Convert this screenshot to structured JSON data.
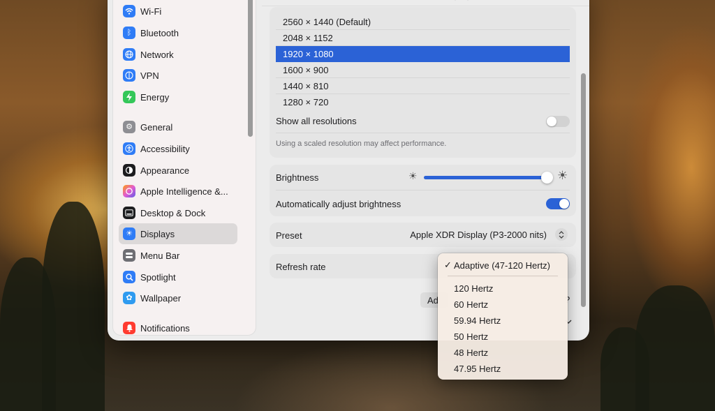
{
  "sidebar": {
    "items": [
      {
        "label": "Wi-Fi",
        "icon": "wifi-icon",
        "color": "#2f7cf6"
      },
      {
        "label": "Bluetooth",
        "icon": "bluetooth-icon",
        "color": "#2f7cf6"
      },
      {
        "label": "Network",
        "icon": "globe-icon",
        "color": "#2f7cf6"
      },
      {
        "label": "VPN",
        "icon": "vpn-icon",
        "color": "#2f7cf6"
      },
      {
        "label": "Energy",
        "icon": "bolt-icon",
        "color": "#34c759"
      },
      {
        "label": "General",
        "icon": "gear-icon",
        "color": "#8e8e93"
      },
      {
        "label": "Accessibility",
        "icon": "accessibility-icon",
        "color": "#2f7cf6"
      },
      {
        "label": "Appearance",
        "icon": "appearance-icon",
        "color": "#1d1d1f"
      },
      {
        "label": "Apple Intelligence &...",
        "icon": "apple-intelligence-icon",
        "color": "#e35bd1"
      },
      {
        "label": "Desktop & Dock",
        "icon": "dock-icon",
        "color": "#1d1d1f"
      },
      {
        "label": "Displays",
        "icon": "sun-icon",
        "color": "#2f7cf6"
      },
      {
        "label": "Menu Bar",
        "icon": "menubar-icon",
        "color": "#6e6e73"
      },
      {
        "label": "Spotlight",
        "icon": "search-icon",
        "color": "#2f7cf6"
      },
      {
        "label": "Wallpaper",
        "icon": "flower-icon",
        "color": "#2f9bf0"
      },
      {
        "label": "Notifications",
        "icon": "bell-icon",
        "color": "#ff3b30"
      }
    ],
    "selected": "Displays"
  },
  "resolutions": {
    "items": [
      "2560 × 1440 (Default)",
      "2048 × 1152",
      "1920 × 1080",
      "1600 × 900",
      "1440 × 810",
      "1280 × 720"
    ],
    "selected": "1920 × 1080",
    "show_all_label": "Show all resolutions",
    "show_all_on": false,
    "note": "Using a scaled resolution may affect performance."
  },
  "brightness": {
    "label": "Brightness",
    "level": 0.98,
    "auto_label": "Automatically adjust brightness",
    "auto_on": true
  },
  "preset": {
    "label": "Preset",
    "value": "Apple XDR Display (P3-2000 nits)"
  },
  "refresh": {
    "label": "Refresh rate"
  },
  "partial": {
    "advanced_button": "Ad",
    "help": "?"
  },
  "dropdown": {
    "check": "✓",
    "selected": "Adaptive (47-120 Hertz)",
    "options": [
      "120 Hertz",
      "60 Hertz",
      "59.94 Hertz",
      "50 Hertz",
      "48 Hertz",
      "47.95 Hertz"
    ]
  },
  "colors": {
    "accent": "#2b62d6"
  }
}
